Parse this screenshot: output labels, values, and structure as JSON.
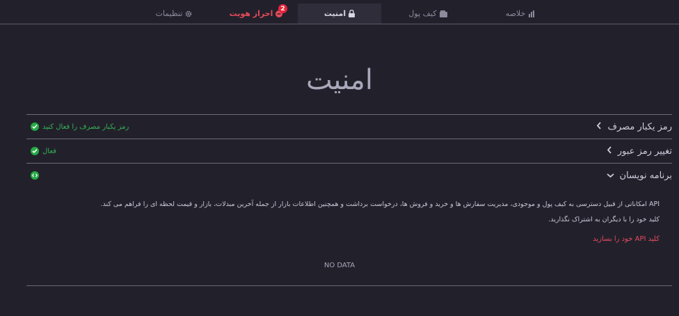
{
  "nav": {
    "tabs": [
      {
        "label": "خلاصه",
        "icon": "bar-chart-icon"
      },
      {
        "label": "کیف پول",
        "icon": "wallet-icon"
      },
      {
        "label": "امنیت",
        "icon": "lock-icon",
        "active": true
      },
      {
        "label": "احراز هویت",
        "icon": "alert-circle-icon",
        "badge": "2"
      },
      {
        "label": "تنظیمات",
        "icon": "gear-icon"
      }
    ]
  },
  "page": {
    "title": "امنیت"
  },
  "sections": [
    {
      "title": "رمز یکبار مصرف",
      "status": "رمز یکبار مصرف را فعال کنید",
      "icon": "chevron-left-icon"
    },
    {
      "title": "تغییر رمز عبور",
      "status": "فعال",
      "icon": "chevron-left-icon"
    },
    {
      "title": "برنامه نویسان",
      "status": "",
      "icon": "chevron-down-icon"
    }
  ],
  "api": {
    "description_line1": "API امکاناتی از قبیل دسترسی به کیف پول و موجودی، مدیریت سفارش ها و خرید و فروش ها، درخواست برداشت و همچنین اطلاعات بازار از جمله آخرین مبدلات، بازار و قیمت لحظه ای را فراهم می کند.",
    "description_line2": "کلید خود را با دیگران به اشتراک نگذارید.",
    "create_link": "کلید API خود را بسازید",
    "empty_state": "NO DATA"
  },
  "colors": {
    "background": "#22212b",
    "accent_red": "#e84a5f",
    "success_green": "#26a946"
  }
}
